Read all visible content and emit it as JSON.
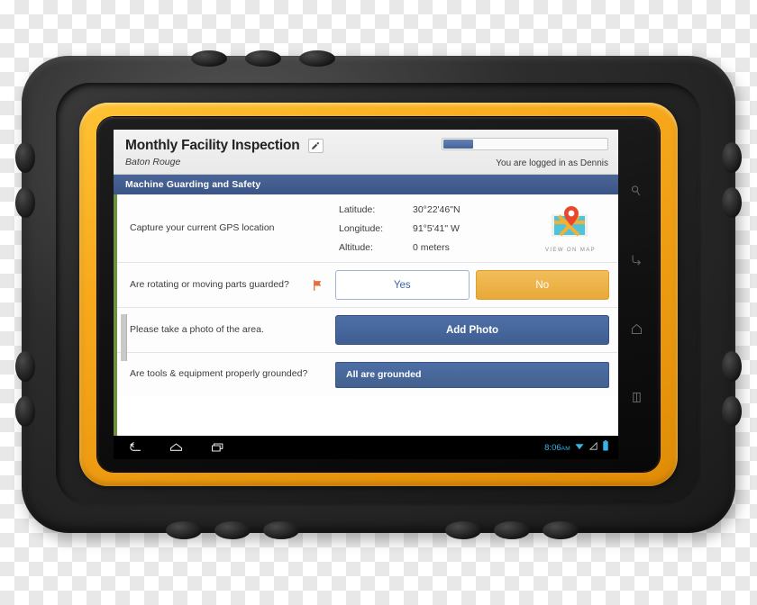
{
  "app": {
    "page_title": "Monthly Facility Inspection",
    "subtitle": "Baton Rouge",
    "edit_icon": "pencil-icon",
    "progress_percent": 18,
    "login_status": "You are logged in as Dennis",
    "section_title": "Machine Guarding and Safety"
  },
  "gps_row": {
    "label": "Capture your current GPS location",
    "fields": [
      {
        "key": "Latitude:",
        "value": "30°22'46\"N"
      },
      {
        "key": "Longitude:",
        "value": "91°5'41\" W"
      },
      {
        "key": "Altitude:",
        "value": "0 meters"
      }
    ],
    "map_caption": "VIEW ON MAP",
    "map_icon": "map-pin-icon"
  },
  "guarded_row": {
    "label": "Are rotating or moving parts guarded?",
    "flag_icon": "flag-icon",
    "yes_label": "Yes",
    "no_label": "No",
    "selected": "No"
  },
  "photo_row": {
    "label": "Please take a photo of the area.",
    "button_label": "Add Photo"
  },
  "grounded_row": {
    "label": "Are tools & equipment properly grounded?",
    "value": "All are grounded"
  },
  "navbar": {
    "back_icon": "back-arrow-icon",
    "home_icon": "home-icon",
    "recents_icon": "recent-apps-icon",
    "time": "8:06",
    "ampm": "AM",
    "wifi_icon": "wifi-icon",
    "signal_icon": "signal-icon",
    "battery_icon": "battery-icon"
  },
  "bezel_keys": [
    {
      "icon": "search-icon"
    },
    {
      "icon": "back-arrow-icon"
    },
    {
      "icon": "home-icon"
    },
    {
      "icon": "menu-icon"
    }
  ],
  "colors": {
    "case_black": "#1a1a1a",
    "case_orange": "#f7a81b",
    "section_blue": "#3a5585",
    "button_blue": "#44629c",
    "selected_orange": "#e9a937",
    "rail_green": "#6d9140",
    "status_cyan": "#33b5e5"
  }
}
